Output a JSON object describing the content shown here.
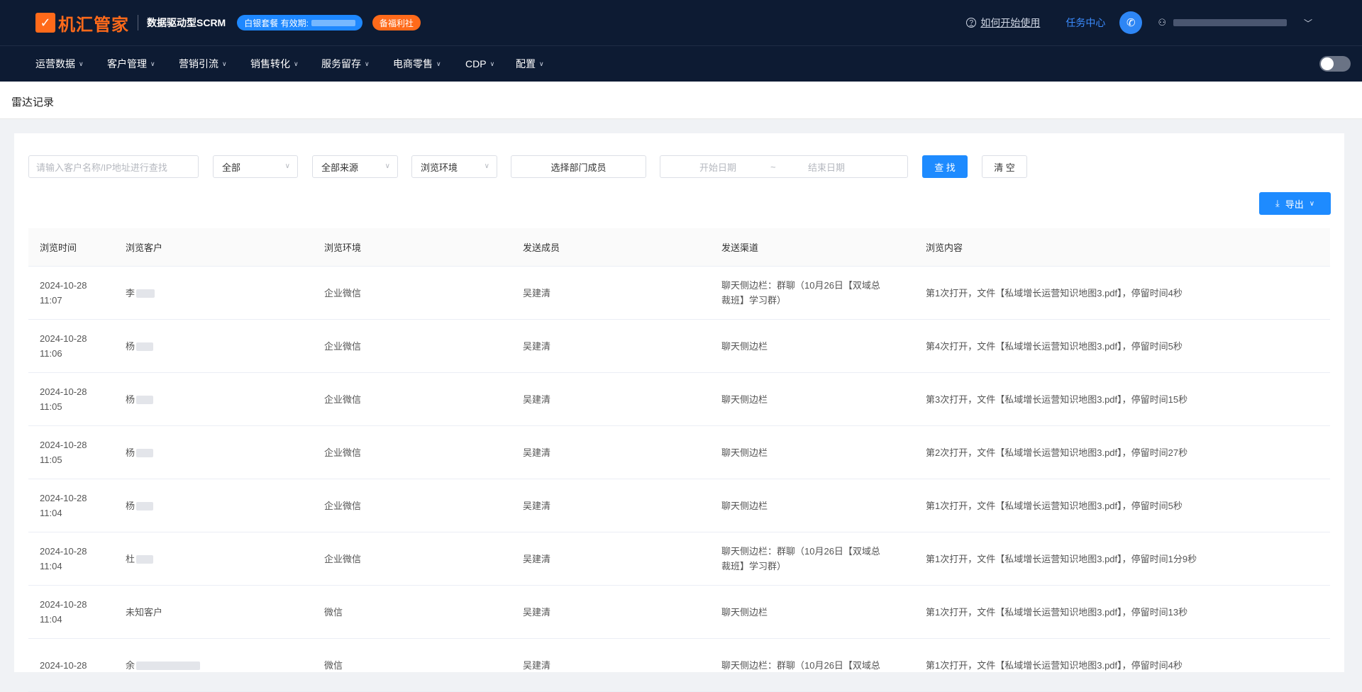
{
  "header": {
    "logo_mark": "✓",
    "logo_text": "机汇管家",
    "subtitle": "数据驱动型SCRM",
    "package_label": "白银套餐 有效期:",
    "welfare_label": "备福利社",
    "help_label": "如何开始使用",
    "task_center_label": "任务中心"
  },
  "nav": {
    "items": [
      {
        "label": "运营数据"
      },
      {
        "label": "客户管理"
      },
      {
        "label": "营销引流"
      },
      {
        "label": "销售转化"
      },
      {
        "label": "服务留存"
      },
      {
        "label": "电商零售"
      },
      {
        "label": "CDP"
      },
      {
        "label": "配置"
      }
    ]
  },
  "page": {
    "title": "雷达记录"
  },
  "filters": {
    "search_placeholder": "请输入客户名称/IP地址进行查找",
    "all_label": "全部",
    "source_label": "全部来源",
    "env_label": "浏览环境",
    "member_label": "选择部门成员",
    "start_date_placeholder": "开始日期",
    "date_sep": "~",
    "end_date_placeholder": "结束日期",
    "search_button": "查 找",
    "clear_button": "清 空",
    "export_button": "导出"
  },
  "table": {
    "headers": [
      "浏览时间",
      "浏览客户",
      "浏览环境",
      "发送成员",
      "发送渠道",
      "浏览内容"
    ],
    "rows": [
      {
        "date": "2024-10-28",
        "time": "11:07",
        "customer": "李",
        "env": "企业微信",
        "member": "吴建清",
        "channel_1": "聊天侧边栏：群聊（10月26日【双域总",
        "channel_2": "裁班】学习群）",
        "content": "第1次打开，文件【私域增长运营知识地图3.pdf】，停留时间4秒"
      },
      {
        "date": "2024-10-28",
        "time": "11:06",
        "customer": "杨",
        "env": "企业微信",
        "member": "吴建清",
        "channel_1": "聊天侧边栏",
        "channel_2": "",
        "content": "第4次打开，文件【私域增长运营知识地图3.pdf】，停留时间5秒"
      },
      {
        "date": "2024-10-28",
        "time": "11:05",
        "customer": "杨",
        "env": "企业微信",
        "member": "吴建清",
        "channel_1": "聊天侧边栏",
        "channel_2": "",
        "content": "第3次打开，文件【私域增长运营知识地图3.pdf】，停留时间15秒"
      },
      {
        "date": "2024-10-28",
        "time": "11:05",
        "customer": "杨",
        "env": "企业微信",
        "member": "吴建清",
        "channel_1": "聊天侧边栏",
        "channel_2": "",
        "content": "第2次打开，文件【私域增长运营知识地图3.pdf】，停留时间27秒"
      },
      {
        "date": "2024-10-28",
        "time": "11:04",
        "customer": "杨",
        "env": "企业微信",
        "member": "吴建清",
        "channel_1": "聊天侧边栏",
        "channel_2": "",
        "content": "第1次打开，文件【私域增长运营知识地图3.pdf】，停留时间5秒"
      },
      {
        "date": "2024-10-28",
        "time": "11:04",
        "customer": "杜",
        "env": "企业微信",
        "member": "吴建清",
        "channel_1": "聊天侧边栏：群聊（10月26日【双域总",
        "channel_2": "裁班】学习群）",
        "content": "第1次打开，文件【私域增长运营知识地图3.pdf】，停留时间1分9秒"
      },
      {
        "date": "2024-10-28",
        "time": "11:04",
        "customer": "未知客户",
        "env": "微信",
        "member": "吴建清",
        "channel_1": "聊天侧边栏",
        "channel_2": "",
        "content": "第1次打开，文件【私域增长运营知识地图3.pdf】，停留时间13秒"
      },
      {
        "date": "2024-10-28",
        "time": "",
        "customer": "余",
        "env": "微信",
        "member": "吴建清",
        "channel_1": "聊天侧边栏：群聊（10月26日【双域总",
        "channel_2": "",
        "content": "第1次打开，文件【私域增长运营知识地图3.pdf】，停留时间4秒"
      }
    ]
  },
  "colors": {
    "topbar_bg": "#0d1b33",
    "brand_orange": "#ff6a1a",
    "primary_blue": "#1e8bff"
  }
}
